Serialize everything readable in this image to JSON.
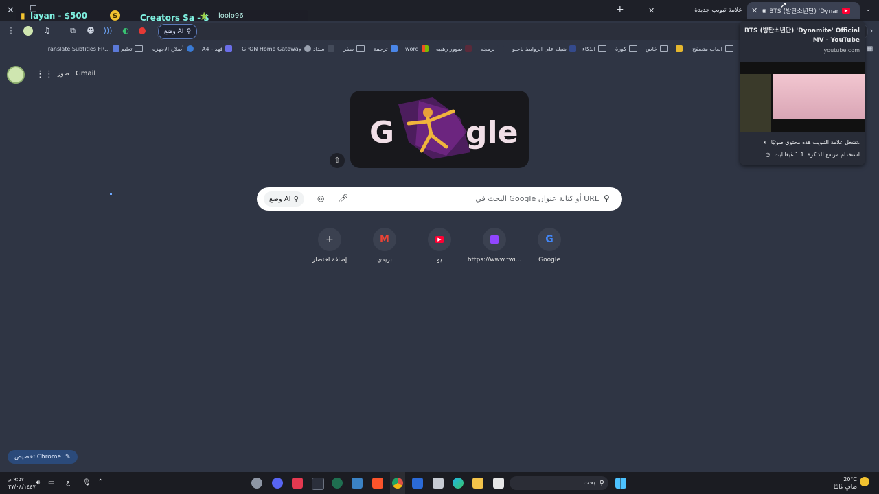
{
  "tabs": [
    {
      "title": "BTS (방탄소년단) 'Dynamite' O",
      "active": true
    },
    {
      "title": "علامة تبويب جديدة",
      "active": false
    }
  ],
  "new_tab_symbol": "+",
  "ticker": {
    "item1": "layan - $500",
    "item2": "Creators Sa - $",
    "item3": "loolo96"
  },
  "toolbar": {
    "ai_mode_label": "وضع AI"
  },
  "bookmarks": [
    "Translate Subtitles FR...",
    "تعليم",
    "أصلاح الاجهزه",
    "A4 - فهد",
    "GPON Home Gateway",
    "سداد",
    "سفر",
    "ترجمة",
    "word",
    "صوور رهيبه",
    "برمجه",
    "شيك على الروابط ياحلو",
    "الذكاء",
    "كورة",
    "خاص",
    "العاب متصفح"
  ],
  "top_links": {
    "gmail": "Gmail",
    "images": "صور"
  },
  "search": {
    "placeholder": "البحث في Google أو كتابة عنوان URL",
    "ai_mode": "وضع AI"
  },
  "shortcuts": [
    {
      "label": "Google",
      "icon": "google-icon"
    },
    {
      "label": "https://www.twi...",
      "icon": "twitch-icon"
    },
    {
      "label": "يو",
      "icon": "youtube-icon"
    },
    {
      "label": "بريدي",
      "icon": "gmail-icon"
    },
    {
      "label": "إضافة اختصار",
      "icon": "plus-icon"
    }
  ],
  "customize_label": "تخصيص Chrome",
  "hover_card": {
    "title": "BTS (방탄소년단) 'Dynamite' Official MV - YouTube",
    "domain": "youtube.com",
    "audio_note": "تشغل علامة التبويب هذه محتوى صوتيًا.",
    "memory_note": "استخدام مرتفع للذاكرة: 1.1 غيغابايت"
  },
  "taskbar": {
    "search_placeholder": "بحث",
    "temperature": "20°C",
    "weather": "صافٍ غالبًا",
    "time": "٩:٥٧ م",
    "date": "٢٧/٠٨/١٤٤٧",
    "lang": "ع"
  },
  "colors": {
    "page_bg": "#2f3544",
    "tabstrip_bg": "#1e2028",
    "accent_blue": "#2b4a7a",
    "youtube_red": "#ff0033",
    "twitch_purple": "#9146ff"
  }
}
